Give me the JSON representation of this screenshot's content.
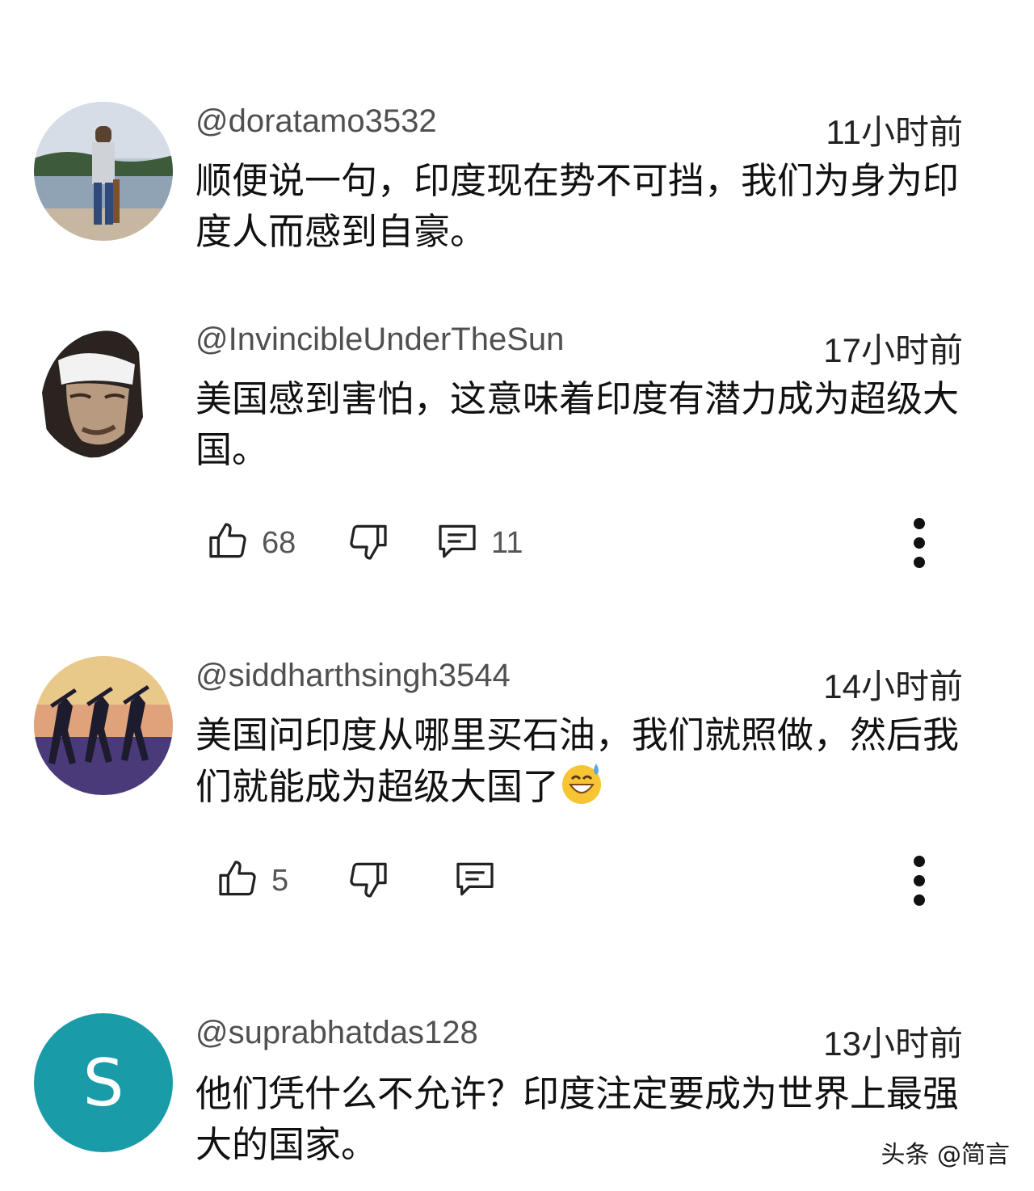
{
  "comments": [
    {
      "handle": "@doratamo3532",
      "time": "11小时前",
      "text": "顺便说一句，印度现在势不可挡，我们为身为印度人而感到自豪。",
      "avatar": "landscape-photo"
    },
    {
      "handle": "@InvincibleUnderTheSun",
      "time": "17小时前",
      "text": "美国感到害怕，这意味着印度有潜力成为超级大国。",
      "avatar": "face-photo",
      "likes": "68",
      "replies": "11"
    },
    {
      "handle": "@siddharthsingh3544",
      "time": "14小时前",
      "text": "美国问印度从哪里买石油，我们就照做，然后我们就能成为超级大国了",
      "emoji": "grinning-sweat-emoji",
      "avatar": "dancers-sunset",
      "likes": "5",
      "replies": ""
    },
    {
      "handle": "@suprabhatdas128",
      "time": "13小时前",
      "text": "他们凭什么不允许？印度注定要成为世界上最强大的国家。",
      "avatar_letter": "S",
      "avatar_color": "#1a9ba8"
    }
  ],
  "watermark": "头条 @简言",
  "icons": {
    "like": "thumbs-up-icon",
    "dislike": "thumbs-down-icon",
    "reply": "comment-icon",
    "more": "more-vert-icon"
  }
}
